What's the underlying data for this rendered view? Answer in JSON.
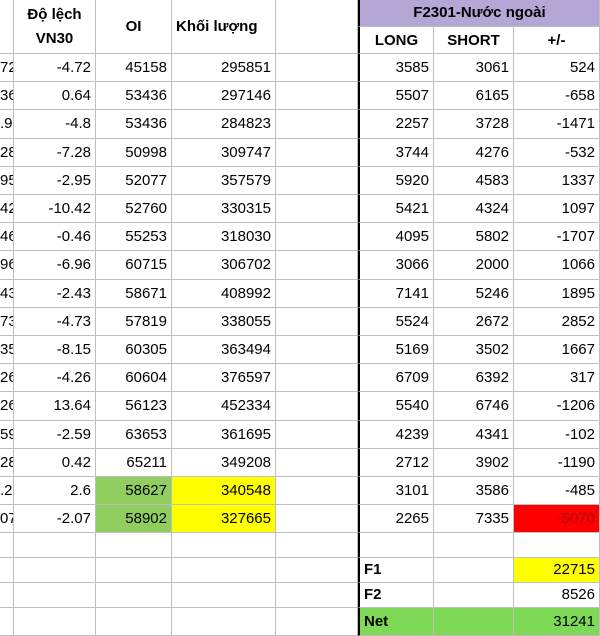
{
  "left_headers": {
    "deviation": "Độ lệch\nVN30",
    "oi": "OI",
    "volume": "Khối lượng"
  },
  "right_title": "F2301-Nước ngoài",
  "right_headers": {
    "long": "LONG",
    "short": "SHORT",
    "diff": "+/-"
  },
  "rows": [
    {
      "a": "72",
      "dev": "-4.72",
      "oi": "45158",
      "vol": "295851",
      "long": "3585",
      "short": "3061",
      "diff": "524"
    },
    {
      "a": "36",
      "dev": "0.64",
      "oi": "53436",
      "vol": "297146",
      "long": "5507",
      "short": "6165",
      "diff": "-658"
    },
    {
      "a": ".9",
      "dev": "-4.8",
      "oi": "53436",
      "vol": "284823",
      "long": "2257",
      "short": "3728",
      "diff": "-1471"
    },
    {
      "a": "28",
      "dev": "-7.28",
      "oi": "50998",
      "vol": "309747",
      "long": "3744",
      "short": "4276",
      "diff": "-532"
    },
    {
      "a": "95",
      "dev": "-2.95",
      "oi": "52077",
      "vol": "357579",
      "long": "5920",
      "short": "4583",
      "diff": "1337"
    },
    {
      "a": "42",
      "dev": "-10.42",
      "oi": "52760",
      "vol": "330315",
      "long": "5421",
      "short": "4324",
      "diff": "1097"
    },
    {
      "a": "46",
      "dev": "-0.46",
      "oi": "55253",
      "vol": "318030",
      "long": "4095",
      "short": "5802",
      "diff": "-1707"
    },
    {
      "a": "96",
      "dev": "-6.96",
      "oi": "60715",
      "vol": "306702",
      "long": "3066",
      "short": "2000",
      "diff": "1066"
    },
    {
      "a": "43",
      "dev": "-2.43",
      "oi": "58671",
      "vol": "408992",
      "long": "7141",
      "short": "5246",
      "diff": "1895"
    },
    {
      "a": "73",
      "dev": "-4.73",
      "oi": "57819",
      "vol": "338055",
      "long": "5524",
      "short": "2672",
      "diff": "2852"
    },
    {
      "a": "35",
      "dev": "-8.15",
      "oi": "60305",
      "vol": "363494",
      "long": "5169",
      "short": "3502",
      "diff": "1667"
    },
    {
      "a": "26",
      "dev": "-4.26",
      "oi": "60604",
      "vol": "376597",
      "long": "6709",
      "short": "6392",
      "diff": "317"
    },
    {
      "a": "26",
      "dev": "13.64",
      "oi": "56123",
      "vol": "452334",
      "long": "5540",
      "short": "6746",
      "diff": "-1206"
    },
    {
      "a": "59",
      "dev": "-2.59",
      "oi": "63653",
      "vol": "361695",
      "long": "4239",
      "short": "4341",
      "diff": "-102"
    },
    {
      "a": "28",
      "dev": "0.42",
      "oi": "65211",
      "vol": "349208",
      "long": "2712",
      "short": "3902",
      "diff": "-1190"
    },
    {
      "a": ".2",
      "dev": "2.6",
      "oi": "58627",
      "vol": "340548",
      "long": "3101",
      "short": "3586",
      "diff": "-485"
    },
    {
      "a": "07",
      "dev": "-2.07",
      "oi": "58902",
      "vol": "327665",
      "long": "2265",
      "short": "7335",
      "diff": "-5070"
    }
  ],
  "summary": [
    {
      "label": "F1",
      "value": "22715"
    },
    {
      "label": "F2",
      "value": "8526"
    },
    {
      "label": "Net",
      "value": "31241"
    }
  ],
  "colors": {
    "oi_highlight": "#8fce5f",
    "volume_highlight": "#ffff00",
    "negative_alert": "#ff0000",
    "title_band": "#b4a7d6",
    "net_band": "#7ed957"
  }
}
